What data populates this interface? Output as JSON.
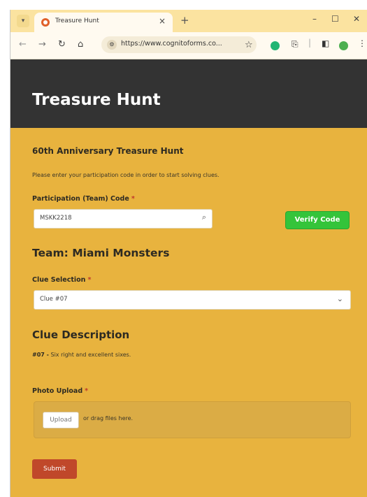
{
  "browser": {
    "tab_title": "Treasure Hunt",
    "tab_close": "×",
    "new_tab": "+",
    "url": "https://www.cognitoforms.co...",
    "minimize": "–",
    "maximize": "☐",
    "close": "✕"
  },
  "form": {
    "page_title": "Treasure Hunt",
    "heading": "60th Anniversary Treasure Hunt",
    "instructions": "Please enter your participation code in order to start solving clues.",
    "participation_label": "Participation (Team) Code",
    "required_marker": "*",
    "participation_value": "MSKK2218",
    "verify_label": "Verify Code",
    "team_heading": "Team: Miami Monsters",
    "clue_label": "Clue Selection",
    "clue_value": "Clue #07",
    "clue_heading": "Clue Description",
    "clue_number": "#07 -",
    "clue_text": "Six right and excellent sixes.",
    "photo_label": "Photo Upload",
    "upload_label": "Upload",
    "drag_text": "or drag files here.",
    "submit_label": "Submit"
  },
  "colors": {
    "accent": "#e8b33e",
    "header": "#333333",
    "verify": "#34c43a",
    "submit": "#c0482a"
  }
}
